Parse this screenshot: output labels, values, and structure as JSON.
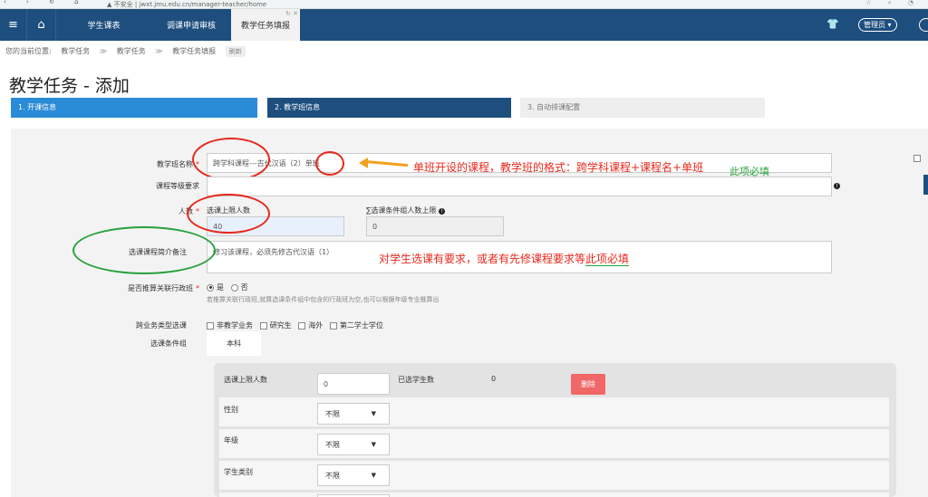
{
  "browser": {
    "security": "不安全",
    "url": "jwxt.jmu.edu.cn/manager-teacher/home"
  },
  "topnav": {
    "tabs": [
      {
        "label": "学生课表"
      },
      {
        "label": "调课申请审核"
      },
      {
        "label": "教学任务填报"
      }
    ],
    "admin_label": "管理员"
  },
  "breadcrumb": {
    "prefix": "您的当前位置:",
    "items": [
      "教学任务",
      "教学任务",
      "教学任务填报"
    ],
    "separator": "≫",
    "refresh": "刷新"
  },
  "page_title": "教学任务 - 添加",
  "steps": [
    "1. 开课信息",
    "2. 教学班信息",
    "3. 自动排课配置"
  ],
  "form": {
    "class_name": {
      "label": "教学班名称",
      "value_prefix": "跨学科课程---古代汉语（2）",
      "value_suffix": "单班"
    },
    "level": {
      "label": "课程等级要求"
    },
    "count": {
      "label": "人数",
      "max_label": "选课上限人数",
      "max_value": "40",
      "sum_label": "∑选课条件组人数上限",
      "sum_value": "0"
    },
    "intro": {
      "label": "选课课程简介备注",
      "value": "修习该课程，必须先修古代汉语（1）"
    },
    "admin_class": {
      "label": "是否推算关联行政班",
      "yes": "是",
      "no": "否",
      "hint": "若推算关联行政班,就算选课条件组中包含的行政班为空,也可以根据年级专业推算出"
    },
    "cross_type": {
      "label": "跨业务类型选课",
      "options": [
        "非教学业务",
        "研究生",
        "海外",
        "第二学士学位"
      ]
    },
    "cond_group": {
      "label": "选课条件组",
      "tab": "本科"
    },
    "cond": {
      "limit_label": "选课上限人数",
      "limit_value": "0",
      "selected_label": "已选学生数",
      "selected_value": "0",
      "delete": "删除",
      "rows": [
        {
          "label": "性别",
          "value": "不限"
        },
        {
          "label": "年级",
          "value": "不限"
        },
        {
          "label": "学生类别",
          "value": "不限"
        }
      ]
    }
  },
  "annotations": {
    "class_note": "单班开设的课程，教学班的格式：跨学科课程+课程名+单班",
    "required_green": "此项必填",
    "intro_note_a": "对学生选课有要求，或者有先修课程要求等",
    "intro_note_b": "此项必填"
  },
  "colors": {
    "nav": "#1d4e7e",
    "step_active": "#2a8bd6",
    "annot_red": "#e8281c",
    "annot_green": "#27a23a",
    "delete": "#f06767"
  }
}
